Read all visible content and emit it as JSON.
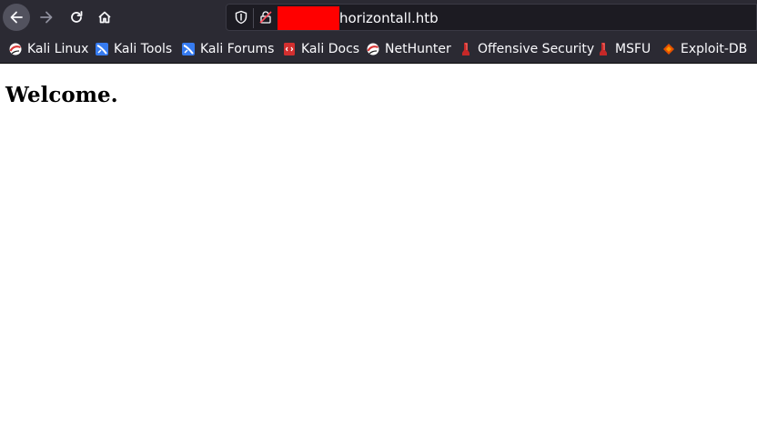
{
  "browser": {
    "url": "horizontall.htb",
    "colors": {
      "chrome": "#2b2a33",
      "urlbar": "#1c1b22",
      "text": "#fbfbfe",
      "redaction": "#ff0000"
    }
  },
  "bookmarks": [
    {
      "label": "Kali Linux",
      "icon": "kali-dragon-icon"
    },
    {
      "label": "Kali Tools",
      "icon": "kali-tools-icon"
    },
    {
      "label": "Kali Forums",
      "icon": "kali-forums-icon"
    },
    {
      "label": "Kali Docs",
      "icon": "kali-docs-icon"
    },
    {
      "label": "NetHunter",
      "icon": "nethunter-icon"
    },
    {
      "label": "Offensive Security",
      "icon": "offensive-security-icon"
    },
    {
      "label": "MSFU",
      "icon": "msfu-icon"
    },
    {
      "label": "Exploit-DB",
      "icon": "exploit-db-icon"
    }
  ],
  "page": {
    "heading": "Welcome."
  }
}
